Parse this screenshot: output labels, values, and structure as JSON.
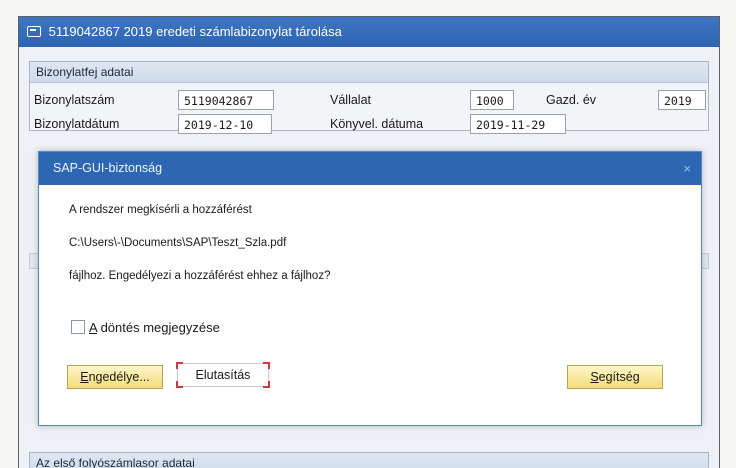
{
  "window": {
    "title": "5119042867 2019 eredeti számlabizonylat tárolása"
  },
  "header_group": {
    "title": "Bizonylatfej adatai",
    "fields": {
      "doc_number_label": "Bizonylatszám",
      "doc_number_value": "5119042867",
      "company_label": "Vállalat",
      "company_value": "1000",
      "fiscal_year_label": "Gazd. év",
      "fiscal_year_value": "2019",
      "doc_date_label": "Bizonylatdátum",
      "doc_date_value": "2019-12-10",
      "posting_date_label": "Könyvel. dátuma",
      "posting_date_value": "2019-11-29"
    }
  },
  "bottom_group": {
    "title": "Az első folyószámlasor adatai"
  },
  "dialog": {
    "title": "SAP-GUI-biztonság",
    "close_glyph": "×",
    "line1": "A rendszer megkísérli a hozzáférést",
    "line2": "C:\\Users\\-\\Documents\\SAP\\Teszt_Szla.pdf",
    "line3": "fájlhoz. Engedélyezi a hozzáférést ehhez a fájlhoz?",
    "checkbox_hotkey": "A",
    "checkbox_rest": " döntés megjegyzése",
    "allow_hotkey": "E",
    "allow_rest": "ngedélye...",
    "deny_label": "Elutasítás",
    "help_hotkey": "S",
    "help_rest": "egítség"
  }
}
